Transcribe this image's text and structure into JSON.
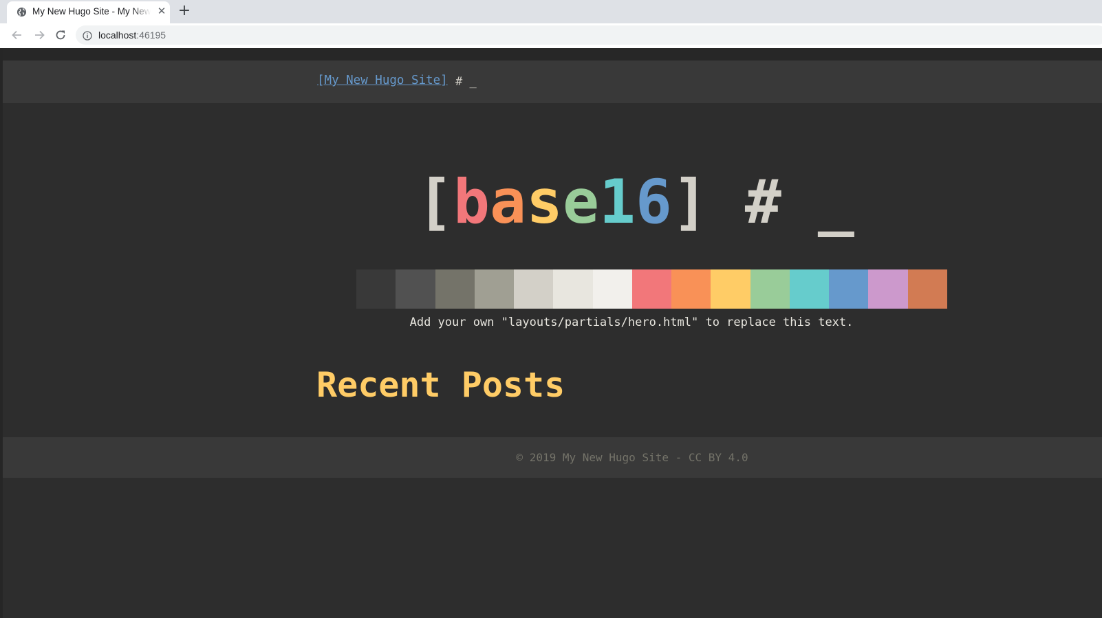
{
  "browser": {
    "tab_title": "My New Hugo Site - My New Hugo Site",
    "tab_close": "✕",
    "new_tab": "+",
    "url_host": "localhost",
    "url_port": ":46195"
  },
  "header": {
    "site_link": "[My New Hugo Site]",
    "prompt": "# _"
  },
  "hero": {
    "title_parts": [
      {
        "text": "[",
        "color": "#d3d0c8"
      },
      {
        "text": "b",
        "color": "#f2777a"
      },
      {
        "text": "a",
        "color": "#f99157"
      },
      {
        "text": "s",
        "color": "#ffcc66"
      },
      {
        "text": "e",
        "color": "#99cc99"
      },
      {
        "text": "1",
        "color": "#66cccc"
      },
      {
        "text": "6",
        "color": "#6699cc"
      },
      {
        "text": "]",
        "color": "#d3d0c8"
      },
      {
        "text": " # _",
        "color": "#d3d0c8"
      }
    ],
    "palette": [
      "#393939",
      "#515151",
      "#747369",
      "#a09f93",
      "#d3d0c8",
      "#e8e6df",
      "#f2f0ec",
      "#f2777a",
      "#f99157",
      "#ffcc66",
      "#99cc99",
      "#66cccc",
      "#6699cc",
      "#cc99cc",
      "#d27b53"
    ],
    "note": "Add your own \"layouts/partials/hero.html\" to replace this text."
  },
  "main": {
    "recent_posts_heading": "Recent Posts"
  },
  "footer": {
    "text": "© 2019 My New Hugo Site - CC BY 4.0"
  },
  "colors": {
    "background": "#2d2d2d",
    "header_bg": "#393939",
    "link": "#6699cc",
    "heading": "#ffcc66"
  }
}
